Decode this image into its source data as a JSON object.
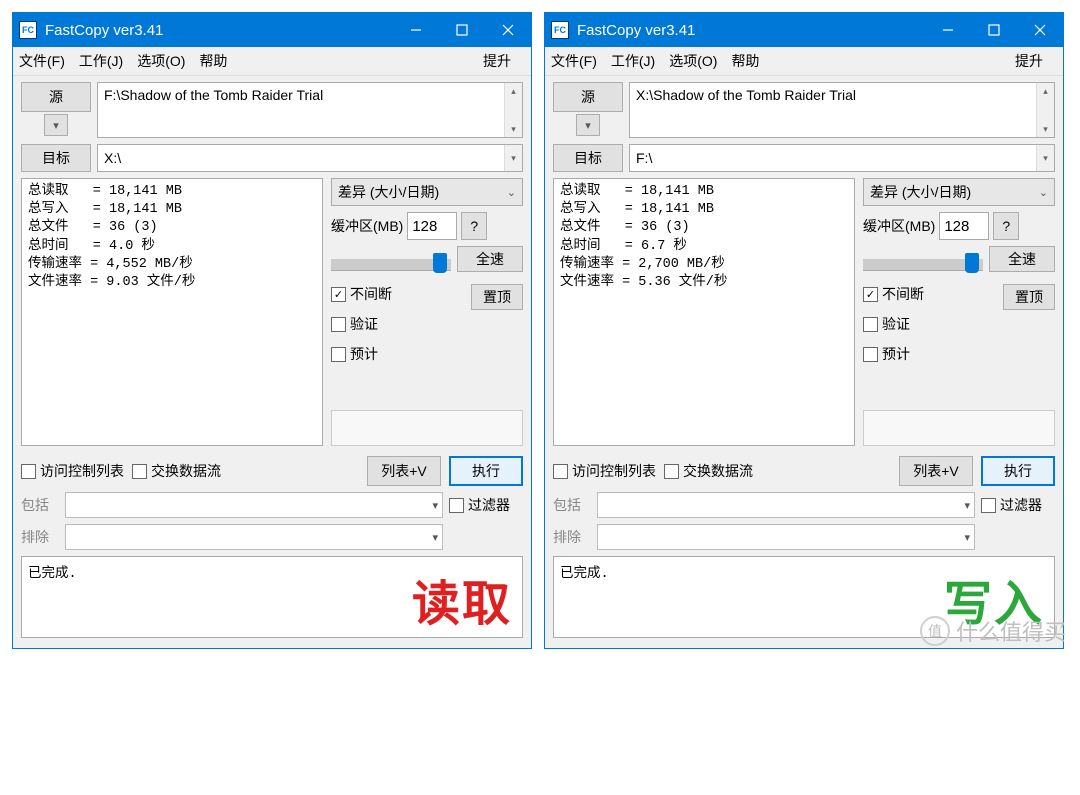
{
  "app": {
    "title": "FastCopy ver3.41",
    "icon_text": "FC"
  },
  "menu": {
    "file": "文件(F)",
    "job": "工作(J)",
    "options": "选项(O)",
    "help": "帮助",
    "boost": "提升"
  },
  "labels": {
    "source": "源",
    "target": "目标",
    "mode_select": "差异 (大小/日期)",
    "buffer": "缓冲区(MB)",
    "question": "?",
    "fullspeed": "全速",
    "nonstop": "不间断",
    "verify": "验证",
    "estimate": "预计",
    "ontop": "置顶",
    "acl": "访问控制列表",
    "altstream": "交换数据流",
    "list_v": "列表+V",
    "execute": "执行",
    "include": "包括",
    "exclude": "排除",
    "filter": "过滤器",
    "done": "已完成."
  },
  "windows": [
    {
      "source_path": "F:\\Shadow of the Tomb Raider Trial",
      "target_path": "X:\\",
      "stats": "总读取   = 18,141 MB\n总写入   = 18,141 MB\n总文件   = 36 (3)\n总时间   = 4.0 秒\n传输速率 = 4,552 MB/秒\n文件速率 = 9.03 文件/秒",
      "buffer_value": "128",
      "nonstop_checked": true,
      "big_label": "读取",
      "big_class": "big-red"
    },
    {
      "source_path": "X:\\Shadow of the Tomb Raider Trial",
      "target_path": "F:\\",
      "stats": "总读取   = 18,141 MB\n总写入   = 18,141 MB\n总文件   = 36 (3)\n总时间   = 6.7 秒\n传输速率 = 2,700 MB/秒\n文件速率 = 5.36 文件/秒",
      "buffer_value": "128",
      "nonstop_checked": true,
      "big_label": "写入",
      "big_class": "big-green"
    }
  ],
  "watermark": {
    "icon": "值",
    "text": "什么值得买"
  }
}
